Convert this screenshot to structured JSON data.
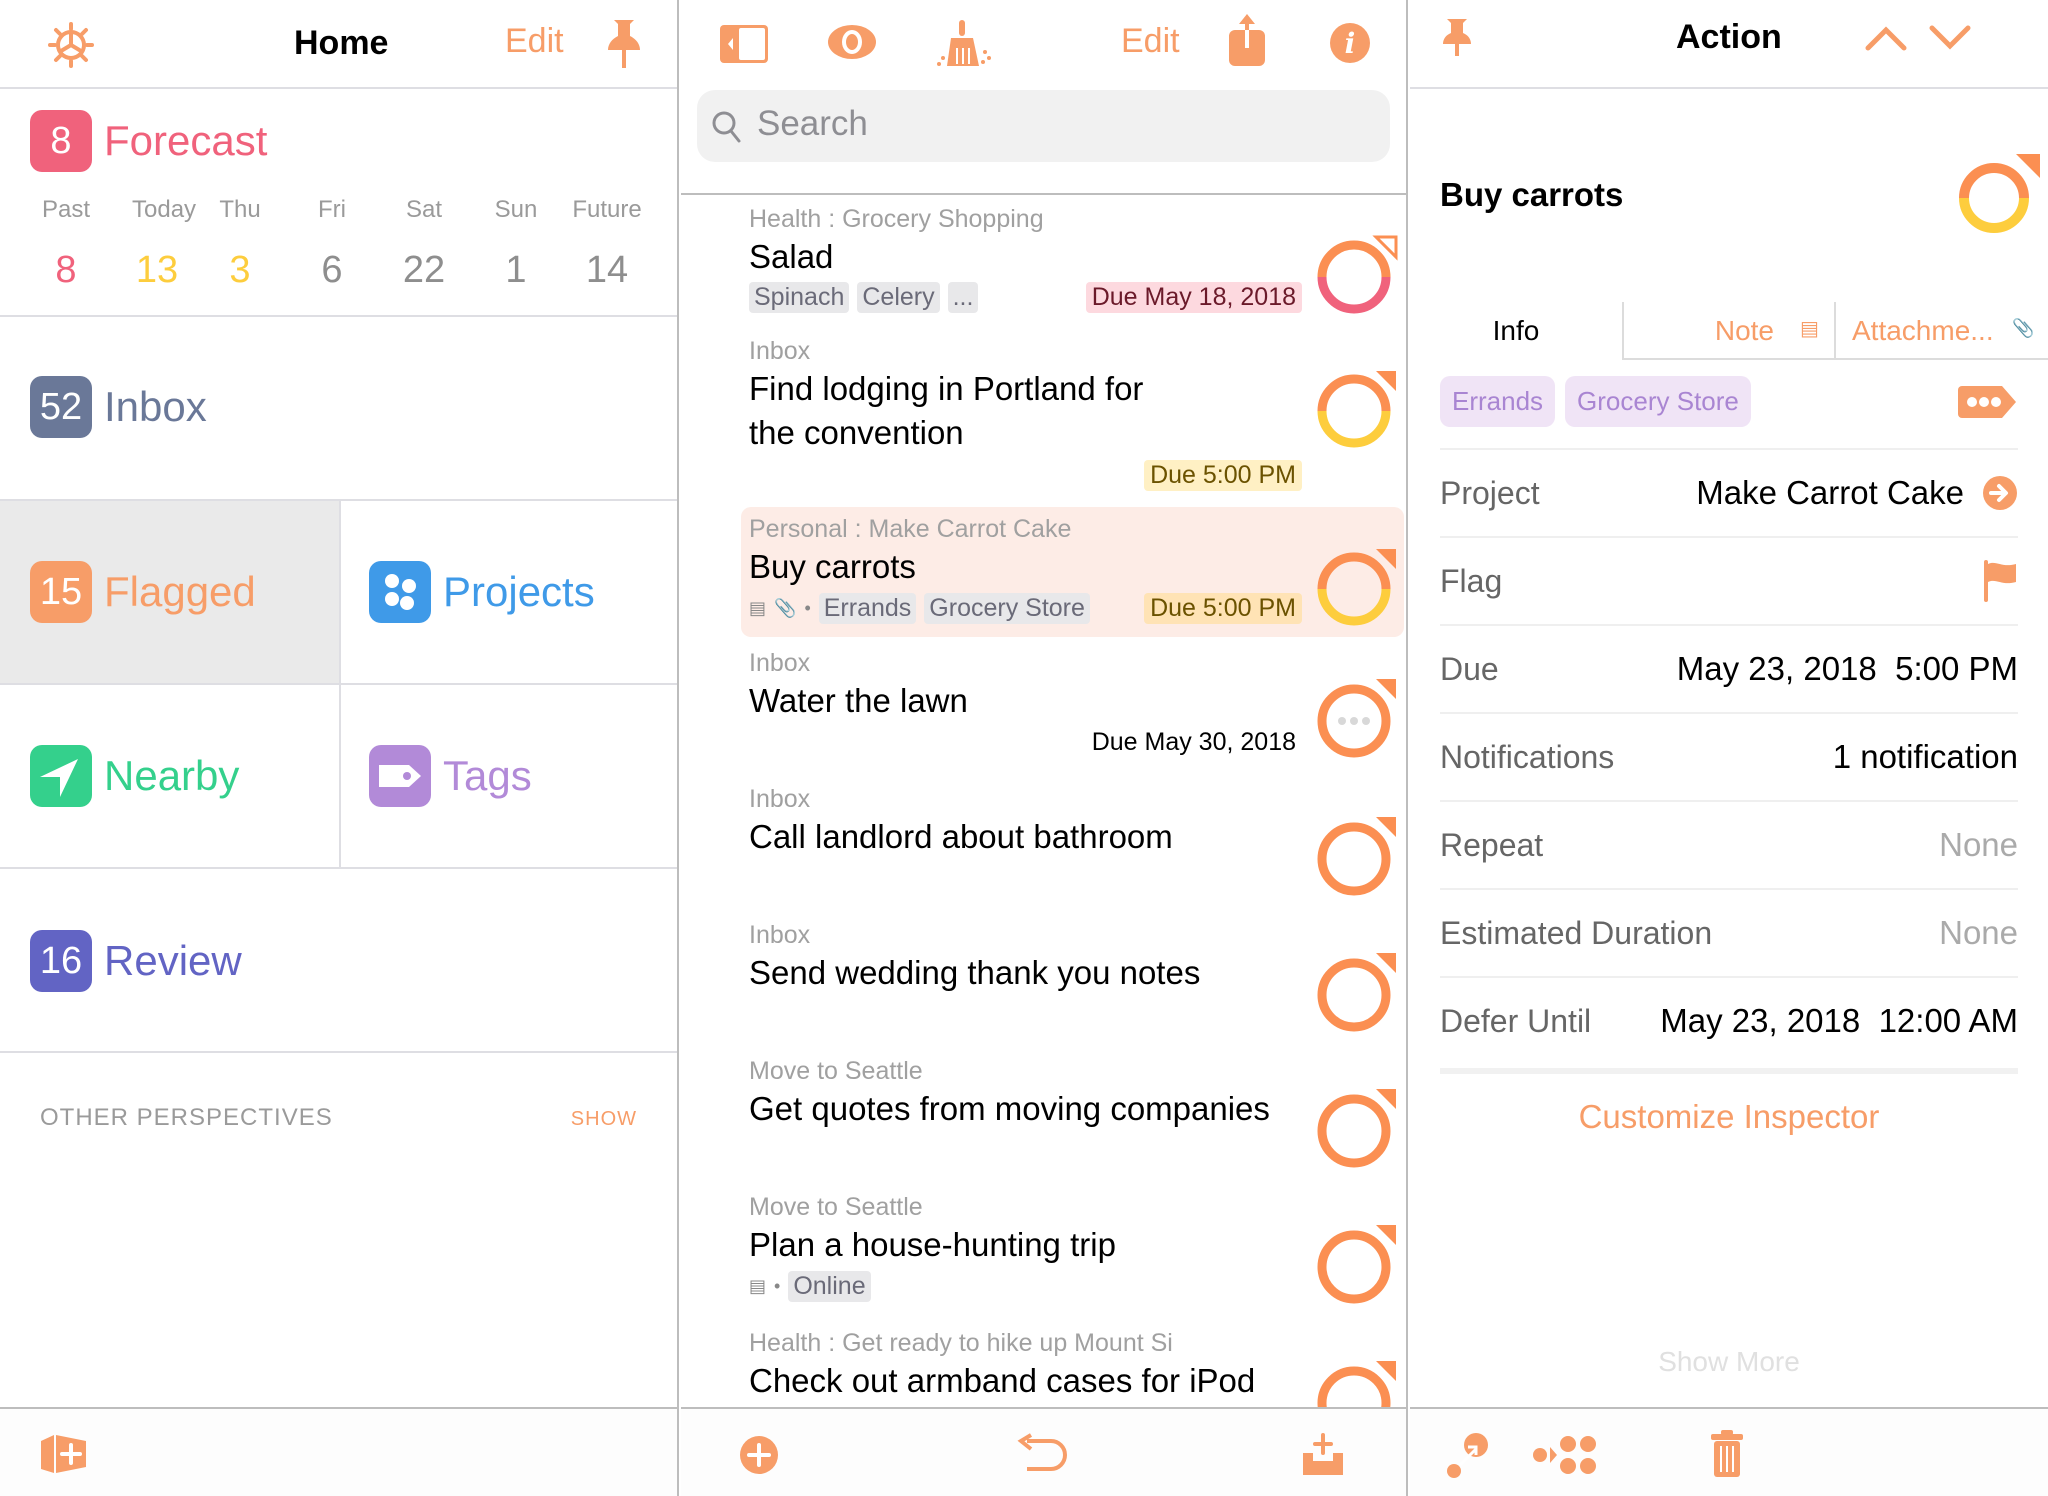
{
  "colors": {
    "accent": "#f79d68",
    "forecast": "#f0627c",
    "inbox": "#6a7898",
    "flagged": "#f79d68",
    "projects": "#3f9ae8",
    "nearby": "#34d08c",
    "tags": "#b28ad8",
    "review": "#6264c4",
    "today": "#fdcd3d"
  },
  "home": {
    "title": "Home",
    "edit_label": "Edit",
    "forecast": {
      "badge": "8",
      "label": "Forecast",
      "days": [
        {
          "label": "Past",
          "count": "8"
        },
        {
          "label": "Today",
          "count": "13"
        },
        {
          "label": "Thu",
          "count": "3"
        },
        {
          "label": "Fri",
          "count": "6"
        },
        {
          "label": "Sat",
          "count": "22"
        },
        {
          "label": "Sun",
          "count": "1"
        },
        {
          "label": "Future",
          "count": "14"
        }
      ]
    },
    "inbox": {
      "badge": "52",
      "label": "Inbox"
    },
    "flagged": {
      "badge": "15",
      "label": "Flagged"
    },
    "projects": {
      "label": "Projects"
    },
    "nearby": {
      "label": "Nearby"
    },
    "tags": {
      "label": "Tags"
    },
    "review": {
      "badge": "16",
      "label": "Review"
    },
    "other_perspectives": "OTHER PERSPECTIVES",
    "show_label": "SHOW"
  },
  "list": {
    "edit_label": "Edit",
    "search_placeholder": "Search",
    "items": [
      {
        "context": "Health : Grocery Shopping",
        "title": "Salad",
        "tags": [
          "Spinach",
          "Celery",
          "..."
        ],
        "due": "Due May 18, 2018",
        "due_style": "red",
        "status": "overdue"
      },
      {
        "context": "Inbox",
        "title_lines": [
          "Find lodging in Portland for",
          "the convention"
        ],
        "due": "Due 5:00 PM",
        "due_style": "yellow",
        "status": "due-soon"
      },
      {
        "context": "Personal : Make Carrot Cake",
        "title": "Buy carrots",
        "tags": [
          "Errands",
          "Grocery Store"
        ],
        "has_note": true,
        "has_attachment": true,
        "due": "Due 5:00 PM",
        "due_style": "yellow",
        "status": "due-soon",
        "selected": true
      },
      {
        "context": "Inbox",
        "title": "Water the lawn",
        "due": "Due May 30, 2018",
        "due_style": "plain",
        "status": "repeating"
      },
      {
        "context": "Inbox",
        "title": "Call landlord about bathroom",
        "status": "flagged"
      },
      {
        "context": "Inbox",
        "title": "Send wedding thank you notes",
        "status": "flagged"
      },
      {
        "context": "Move to Seattle",
        "title": "Get quotes from moving companies",
        "status": "flagged"
      },
      {
        "context": "Move to Seattle",
        "title": "Plan a house-hunting trip",
        "tags": [
          "Online"
        ],
        "has_note": true,
        "status": "flagged"
      },
      {
        "context": "Health : Get ready to hike up Mount Si",
        "title": "Check out armband cases for iPod",
        "status": "flagged"
      }
    ]
  },
  "inspector": {
    "title": "Action",
    "task_title": "Buy carrots",
    "tabs": [
      "Info",
      "Note",
      "Attachme..."
    ],
    "tags": [
      "Errands",
      "Grocery Store"
    ],
    "fields": [
      {
        "key": "Project",
        "value": "Make Carrot Cake"
      },
      {
        "key": "Flag",
        "value": ""
      },
      {
        "key": "Due",
        "value": "May 23, 2018  5:00 PM"
      },
      {
        "key": "Notifications",
        "value": "1 notification"
      },
      {
        "key": "Repeat",
        "value": "None"
      },
      {
        "key": "Estimated Duration",
        "value": "None"
      },
      {
        "key": "Defer Until",
        "value": "May 23, 2018  12:00 AM"
      }
    ],
    "customize_label": "Customize Inspector",
    "show_more_label": "Show More"
  }
}
